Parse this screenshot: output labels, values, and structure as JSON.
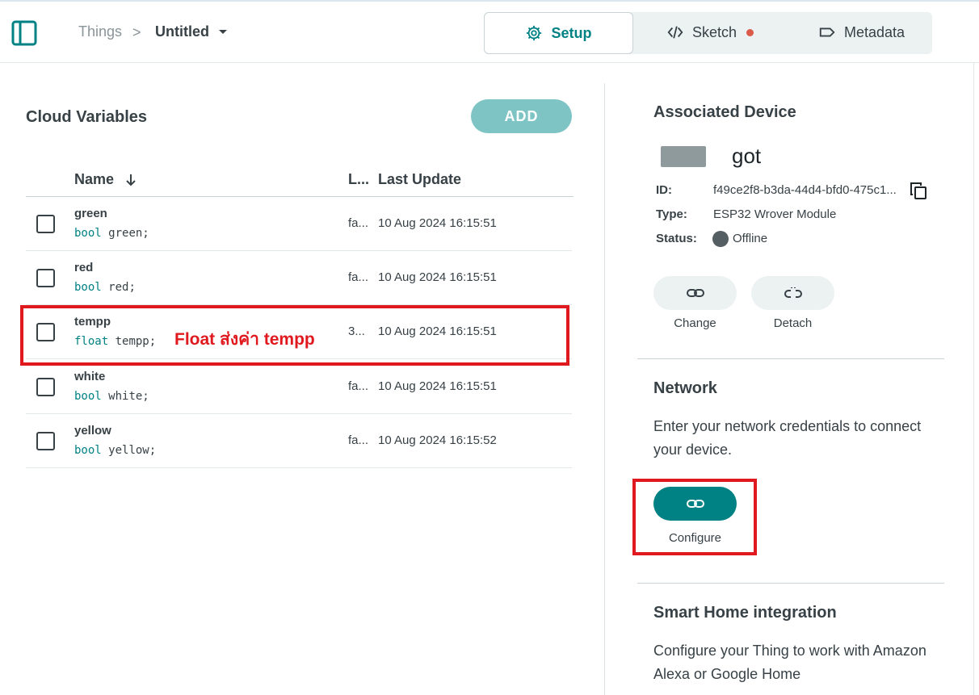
{
  "breadcrumb": {
    "root": "Things",
    "separator": ">",
    "current": "Untitled"
  },
  "tabs": [
    {
      "label": "Setup",
      "icon": "gear-icon",
      "active": true
    },
    {
      "label": "Sketch",
      "icon": "code-icon",
      "badge": "red-dot"
    },
    {
      "label": "Metadata",
      "icon": "tag-icon"
    }
  ],
  "cloud_variables": {
    "title": "Cloud Variables",
    "add_label": "ADD",
    "columns": {
      "name": "Name",
      "last_value": "L...",
      "last_update": "Last Update"
    },
    "rows": [
      {
        "name": "green",
        "type": "bool",
        "decl": "green;",
        "value": "fa...",
        "updated": "10 Aug 2024 16:15:51"
      },
      {
        "name": "red",
        "type": "bool",
        "decl": "red;",
        "value": "fa...",
        "updated": "10 Aug 2024 16:15:51"
      },
      {
        "name": "tempp",
        "type": "float",
        "decl": "tempp;",
        "value": "3...",
        "updated": "10 Aug 2024 16:15:51"
      },
      {
        "name": "white",
        "type": "bool",
        "decl": "white;",
        "value": "fa...",
        "updated": "10 Aug 2024 16:15:51"
      },
      {
        "name": "yellow",
        "type": "bool",
        "decl": "yellow;",
        "value": "fa...",
        "updated": "10 Aug 2024 16:15:52"
      }
    ],
    "annotation": "Float ส่งค่า tempp"
  },
  "device": {
    "title": "Associated Device",
    "name": "got",
    "id_label": "ID:",
    "id": "f49ce2f8-b3da-44d4-bfd0-475c1...",
    "type_label": "Type:",
    "type": "ESP32 Wrover Module",
    "status_label": "Status:",
    "status": "Offline",
    "change_label": "Change",
    "detach_label": "Detach"
  },
  "network": {
    "title": "Network",
    "text": "Enter your network credentials to connect your device.",
    "configure_label": "Configure"
  },
  "smart_home": {
    "title": "Smart Home integration",
    "text": "Configure your Thing to work with Amazon Alexa or Google Home"
  },
  "colors": {
    "accent": "#008184",
    "add_button": "#7fc4c4",
    "annotation": "#e0191f",
    "dot": "#da5b4a"
  }
}
